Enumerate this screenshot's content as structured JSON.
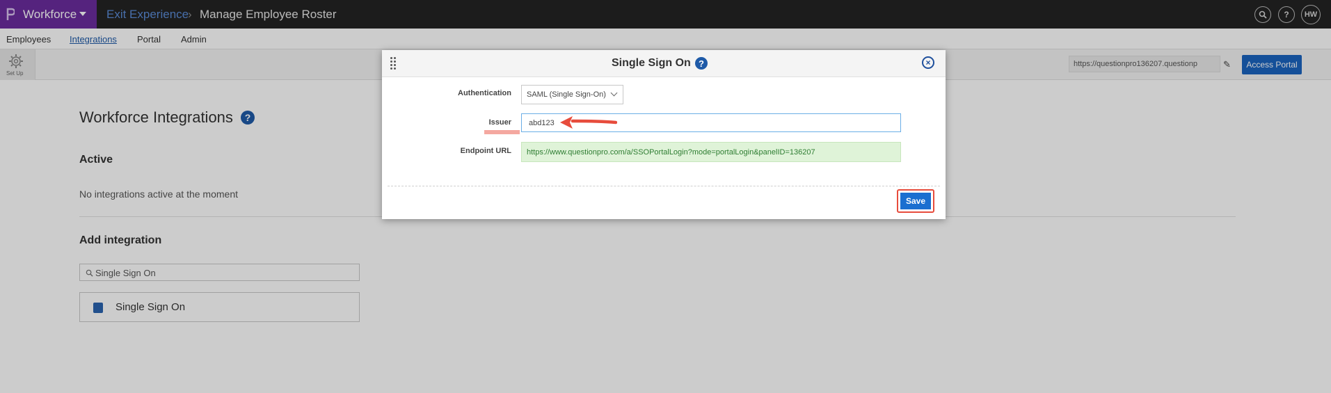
{
  "topbar": {
    "brand": "Workforce",
    "breadcrumb": [
      "Exit Experience",
      "Manage Employee Roster"
    ],
    "avatar": "HW"
  },
  "subnav": [
    "Employees",
    "Integrations",
    "Portal",
    "Admin"
  ],
  "toolbar": {
    "setup_label": "Set Up",
    "portal_url": "https://questionpro136207.questionp",
    "access_portal": "Access Portal"
  },
  "main": {
    "title": "Workforce Integrations",
    "active_heading": "Active",
    "no_integrations": "No integrations active at the moment",
    "add_heading": "Add integration",
    "search_value": "Single Sign On",
    "integration_name": "Single Sign On"
  },
  "modal": {
    "title": "Single Sign On",
    "auth_label": "Authentication",
    "auth_value": "SAML (Single Sign-On)",
    "issuer_label": "Issuer",
    "issuer_value": "abd123",
    "endpoint_label": "Endpoint URL",
    "endpoint_value": "https://www.questionpro.com/a/SSOPortalLogin?mode=portalLogin&panelID=136207",
    "save_label": "Save"
  },
  "colors": {
    "brand": "#6b2c9e",
    "accent": "#1b64c0",
    "highlight": "#e74c3c"
  }
}
